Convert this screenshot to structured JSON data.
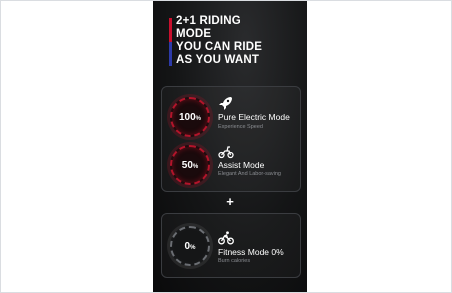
{
  "heading": {
    "lines": [
      "2+1 RIDING",
      "MODE",
      "YOU CAN RIDE",
      "AS YOU WANT"
    ]
  },
  "modes": [
    {
      "percent": "100",
      "unit": "%",
      "name": "Pure Electric Mode",
      "subtitle": "Experience Speed",
      "icon": "rocket-icon"
    },
    {
      "percent": "50",
      "unit": "%",
      "name": "Assist Mode",
      "subtitle": "Elegant And Labor-saving",
      "icon": "scooter-icon"
    }
  ],
  "plus_sign": "+",
  "fitness": {
    "percent": "0",
    "unit": "%",
    "name": "Fitness Mode 0%",
    "subtitle": "Burn calories",
    "icon": "cyclist-icon"
  },
  "colors": {
    "accent_red": "#c8102e",
    "accent_blue": "#2d3aa8",
    "panel_bg": "#141516"
  }
}
